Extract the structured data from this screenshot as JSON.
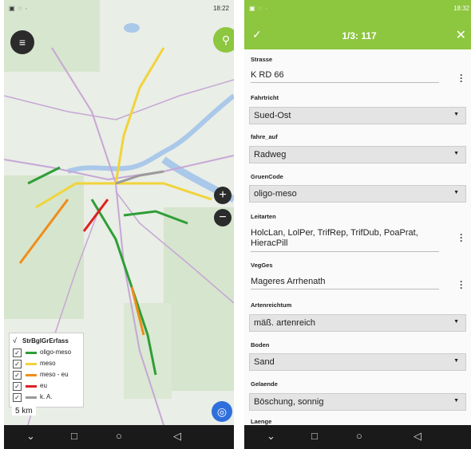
{
  "left_screen": {
    "status_bar": {
      "time": "18:22"
    },
    "legend": {
      "title": "StrBglGrErfass",
      "items": [
        {
          "label": "oligo-meso",
          "color": "#2e9e37"
        },
        {
          "label": "meso",
          "color": "#f2d33a"
        },
        {
          "label": "meso - eu",
          "color": "#f08c19"
        },
        {
          "label": "eu",
          "color": "#e02020"
        },
        {
          "label": "k. A.",
          "color": "#9a9a9a"
        }
      ]
    },
    "scale": "5 km",
    "colors": {
      "fab_green": "#8dc63f",
      "fab_dark": "#2b2b2b",
      "water": "#aac8ea"
    }
  },
  "right_screen": {
    "status_bar": {
      "time": "18:32"
    },
    "header": {
      "title": "1/3: 117"
    },
    "fields": [
      {
        "label": "Strasse",
        "value": "K RD 66",
        "type": "text"
      },
      {
        "label": "Fahrtricht",
        "value": "Sued-Ost",
        "type": "select"
      },
      {
        "label": "fahre_auf",
        "value": "Radweg",
        "type": "select"
      },
      {
        "label": "GruenCode",
        "value": "oligo-meso",
        "type": "select"
      },
      {
        "label": "Leitarten",
        "value": "HolcLan, LolPer, TrifRep, TrifDub, PoaPrat, HieracPill",
        "type": "text"
      },
      {
        "label": "VegGes",
        "value": "Mageres Arrhenath",
        "type": "text"
      },
      {
        "label": "Artenreichtum",
        "value": "mäß. artenreich",
        "type": "select"
      },
      {
        "label": "Boden",
        "value": "Sand",
        "type": "select"
      },
      {
        "label": "Gelaende",
        "value": "Böschung, sonnig",
        "type": "select"
      },
      {
        "label": "Laenge",
        "value": "",
        "type": "text"
      }
    ],
    "colors": {
      "accent": "#8dc63f"
    }
  }
}
